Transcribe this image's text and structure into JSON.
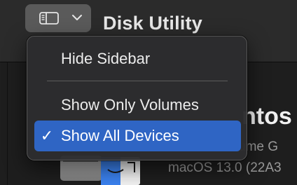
{
  "app": {
    "title": "Disk Utility"
  },
  "toolbar": {
    "sidebar_toggle_icon": "sidebar-icon",
    "dropdown_icon": "chevron-down-icon"
  },
  "menu": {
    "items": [
      {
        "label": "Hide Sidebar",
        "selected": false,
        "checked": false
      },
      {
        "label": "Show Only Volumes",
        "selected": false,
        "checked": false
      },
      {
        "label": "Show All Devices",
        "selected": true,
        "checked": true,
        "check_glyph": "✓"
      }
    ],
    "highlight_color": "#2f65c4"
  },
  "volume": {
    "name_partial": "ntos",
    "type_partial": "ume G",
    "os_partial": "macOS 13.0 (22A3"
  },
  "colors": {
    "background": "#1e1e1e",
    "toolbar": "#2b2b2b",
    "menu": "#2c2c2e",
    "toggle_button": "#5a5a5a",
    "text_primary": "#ececec",
    "text_secondary": "#9a9a9a"
  }
}
